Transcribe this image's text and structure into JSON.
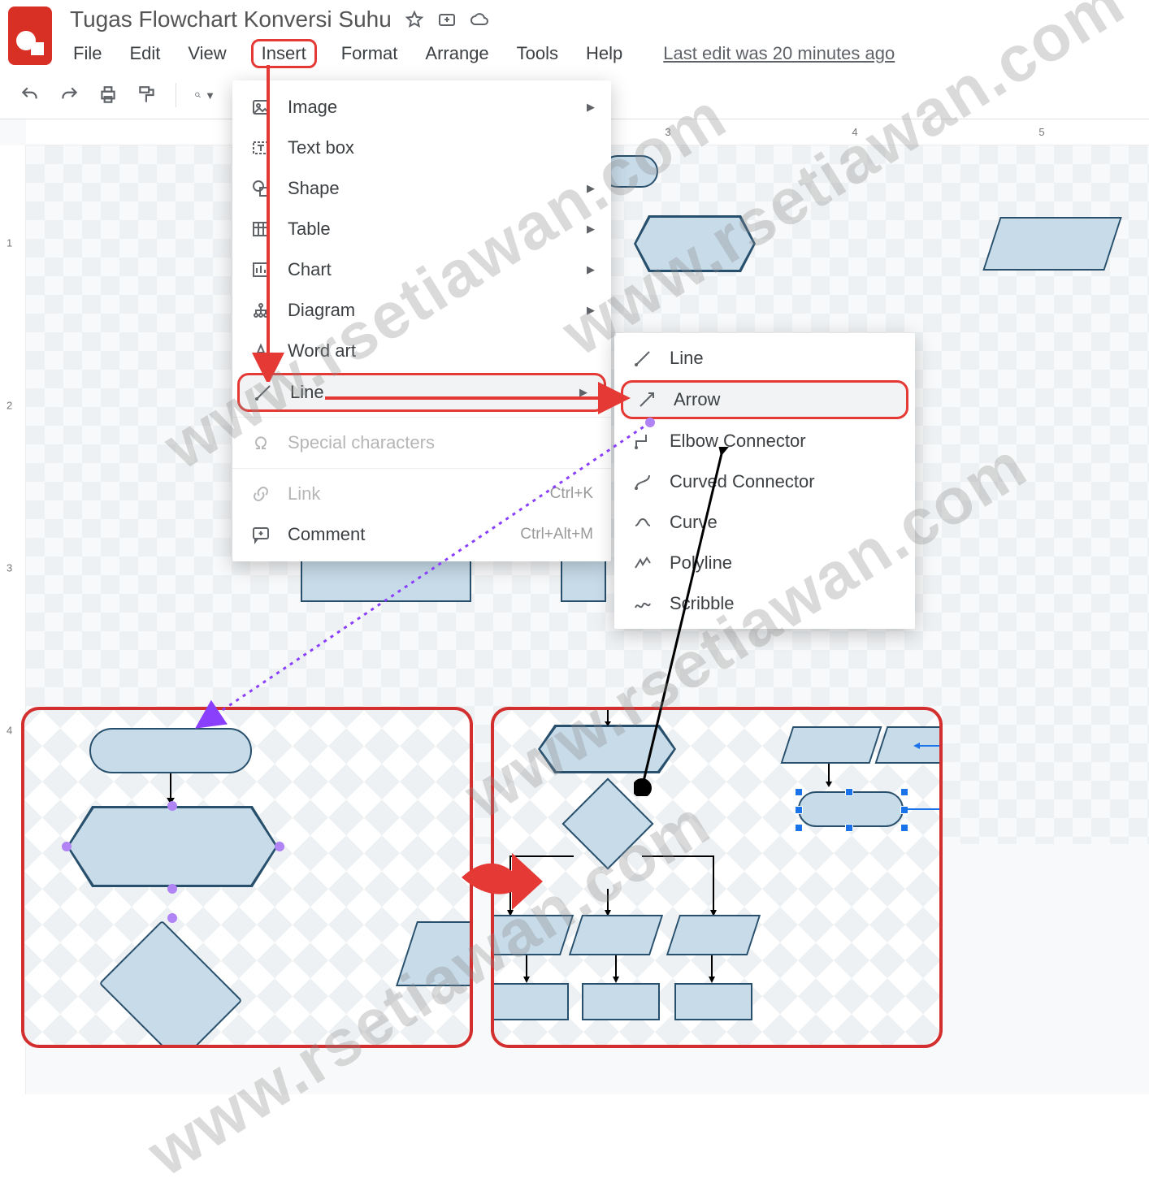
{
  "doc": {
    "title": "Tugas Flowchart Konversi Suhu",
    "last_edit": "Last edit was 20 minutes ago"
  },
  "menus": {
    "file": "File",
    "edit": "Edit",
    "view": "View",
    "insert": "Insert",
    "format": "Format",
    "arrange": "Arrange",
    "tools": "Tools",
    "help": "Help"
  },
  "insert_menu": {
    "image": "Image",
    "textbox": "Text box",
    "shape": "Shape",
    "table": "Table",
    "chart": "Chart",
    "diagram": "Diagram",
    "wordart": "Word art",
    "line": "Line",
    "special": "Special characters",
    "link": "Link",
    "link_shortcut": "Ctrl+K",
    "comment": "Comment",
    "comment_shortcut": "Ctrl+Alt+M"
  },
  "line_submenu": {
    "line": "Line",
    "arrow": "Arrow",
    "elbow": "Elbow Connector",
    "curved": "Curved Connector",
    "curve": "Curve",
    "polyline": "Polyline",
    "scribble": "Scribble"
  },
  "ruler": {
    "v": [
      "1",
      "2",
      "3",
      "4"
    ],
    "h": [
      "3",
      "4",
      "5"
    ]
  },
  "watermark": "www.rsetiawan.com"
}
